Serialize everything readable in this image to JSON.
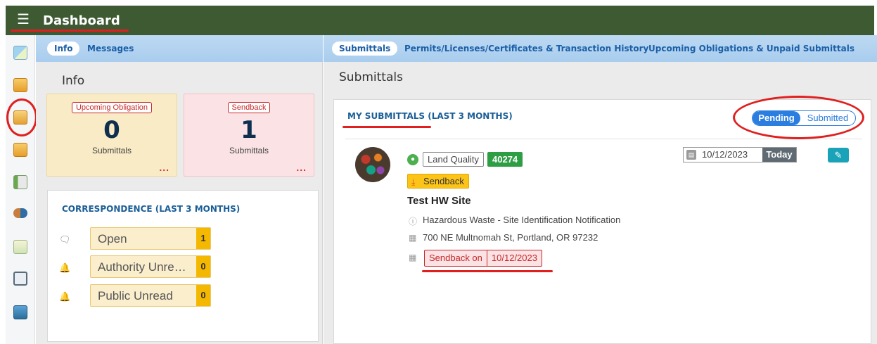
{
  "header": {
    "menu_icon": "hamburger-menu-icon",
    "title": "Dashboard",
    "bar_color": "#3e5a33"
  },
  "sidebar": {
    "icons": [
      "dashboard-icon",
      "new-folder-icon",
      "edit-folder-icon",
      "folder-icon",
      "ledger-icon",
      "handshake-icon",
      "report-icon",
      "monitor-search-icon",
      "badge-icon"
    ]
  },
  "left_tabs": [
    {
      "label": "Info",
      "active": true
    },
    {
      "label": "Messages",
      "active": false
    }
  ],
  "right_tabs": [
    {
      "label": "Submittals",
      "active": true
    },
    {
      "label": "Permits/Licenses/Certificates & Transaction History",
      "active": false
    },
    {
      "label": "Upcoming Obligations & Unpaid Submittals",
      "active": false
    }
  ],
  "info": {
    "title": "Info",
    "cards": [
      {
        "badge": "Upcoming Obligation",
        "count": "0",
        "sub": "Submittals",
        "more": "..."
      },
      {
        "badge": "Sendback",
        "count": "1",
        "sub": "Submittals",
        "more": "..."
      }
    ],
    "correspondence": {
      "title": "CORRESPONDENCE (LAST 3 MONTHS)",
      "rows": [
        {
          "icon": "chat-icon",
          "label": "Open",
          "count": "1"
        },
        {
          "icon": "bell-icon",
          "label": "Authority Unre…",
          "count": "0"
        },
        {
          "icon": "bell-icon",
          "label": "Public Unread",
          "count": "0"
        }
      ]
    }
  },
  "submittals": {
    "title": "Submittals",
    "heading": "MY SUBMITTALS (LAST 3 MONTHS)",
    "toggle": {
      "on": "Pending",
      "off": "Submitted"
    },
    "item": {
      "program": "Land Quality",
      "id": "40274",
      "date": "10/12/2023",
      "date_tag": "Today",
      "status": "Sendback",
      "site": "Test HW Site",
      "form": "Hazardous Waste - Site Identification Notification",
      "address": "700 NE Multnomah St, Portland, OR 97232",
      "sendback_label": "Sendback on",
      "sendback_date": "10/12/2023"
    }
  },
  "colors": {
    "accent_blue": "#1b5fa8",
    "annotation_red": "#e01f1f",
    "sendback_yellow": "#fcc419",
    "id_green": "#2e9e44"
  }
}
